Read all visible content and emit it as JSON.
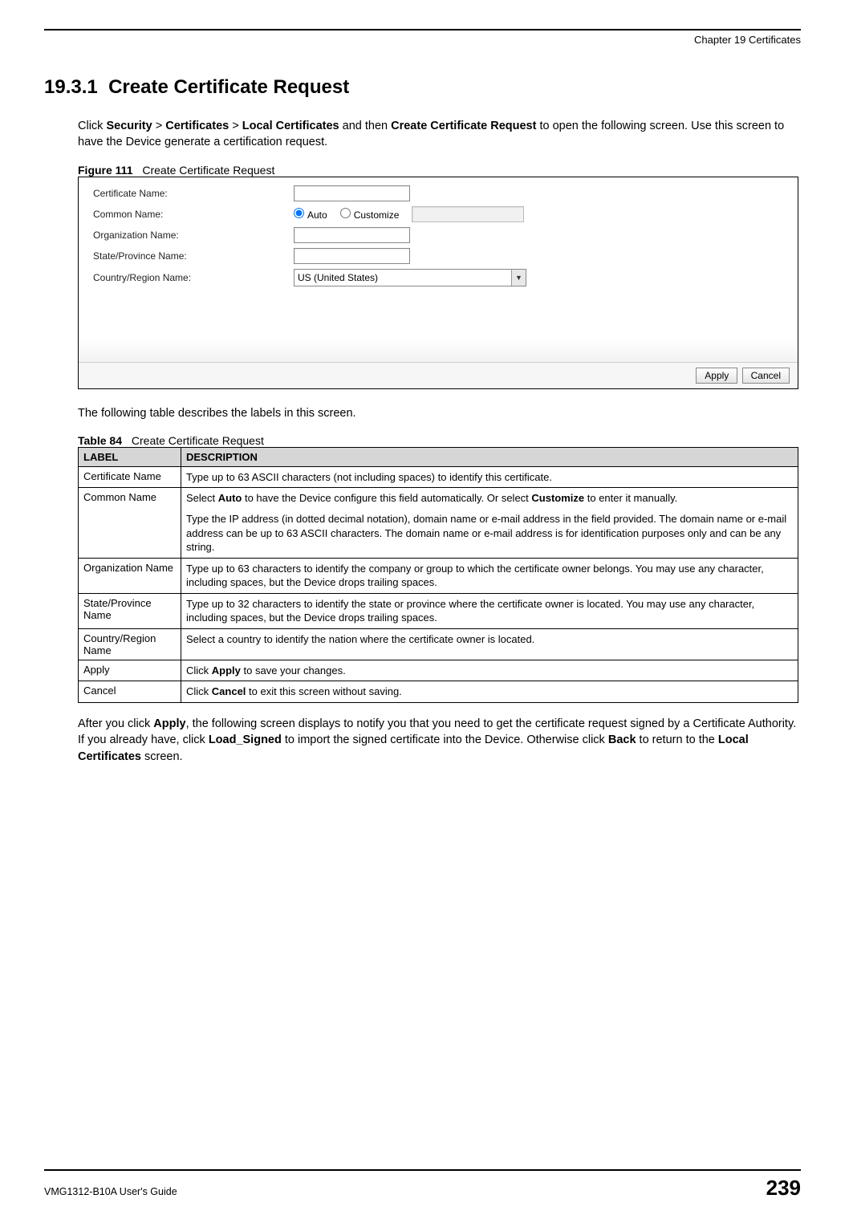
{
  "header": {
    "chapter": "Chapter 19 Certificates"
  },
  "section": {
    "number": "19.3.1",
    "title": "Create Certificate Request"
  },
  "intro": {
    "pre": "Click ",
    "nav1": "Security",
    "sep1": " > ",
    "nav2": "Certificates",
    "sep2": " > ",
    "nav3": "Local Certificates",
    "mid": " and then ",
    "action": "Create Certificate Request",
    "post": " to open the following screen. Use this screen to have the Device generate a certification request."
  },
  "figure": {
    "label": "Figure 111",
    "caption": "Create Certificate Request",
    "form": {
      "cert_name_label": "Certificate Name:",
      "common_name_label": "Common Name:",
      "radio_auto": "Auto",
      "radio_customize": "Customize",
      "org_name_label": "Organization Name:",
      "state_name_label": "State/Province Name:",
      "country_name_label": "Country/Region Name:",
      "country_value": "US (United States)",
      "apply_label": "Apply",
      "cancel_label": "Cancel"
    }
  },
  "table_intro": "The following table describes the labels in this screen.",
  "table": {
    "label": "Table 84",
    "caption": "Create Certificate Request",
    "header_label": "LABEL",
    "header_desc": "DESCRIPTION",
    "rows": [
      {
        "label": "Certificate Name",
        "desc": "Type up to 63 ASCII characters (not including spaces) to identify this certificate."
      },
      {
        "label": "Common Name",
        "desc_p1_a": "Select ",
        "desc_p1_b": "Auto",
        "desc_p1_c": " to have the Device configure this field automatically. Or select ",
        "desc_p1_d": "Customize",
        "desc_p1_e": " to enter it manually.",
        "desc_p2": "Type the IP address (in dotted decimal notation), domain name or e-mail address in the field provided. The domain name or e-mail address can be up to 63 ASCII characters. The domain name or e-mail address is for identification purposes only and can be any string."
      },
      {
        "label": "Organization Name",
        "desc": "Type up to 63 characters to identify the company or group to which the certificate owner belongs. You may use any character, including spaces, but the Device drops trailing spaces."
      },
      {
        "label": "State/Province Name",
        "desc": "Type up to 32 characters to identify the state or province where the certificate owner is located. You may use any character, including spaces, but the Device drops trailing spaces."
      },
      {
        "label": "Country/Region Name",
        "desc": "Select a country to identify the nation where the certificate owner is located."
      },
      {
        "label": "Apply",
        "desc_a": "Click ",
        "desc_b": "Apply",
        "desc_c": " to save your changes."
      },
      {
        "label": "Cancel",
        "desc_a": "Click ",
        "desc_b": "Cancel",
        "desc_c": " to exit this screen without saving."
      }
    ]
  },
  "outro": {
    "a": "After you click ",
    "b": "Apply",
    "c": ", the following screen displays to notify you that you need to get the certificate request signed by a Certificate Authority. If you already have, click ",
    "d": "Load_Signed",
    "e": " to import the signed certificate into the Device. Otherwise click ",
    "f": "Back",
    "g": " to return to the ",
    "h": "Local Certificates",
    "i": " screen."
  },
  "footer": {
    "guide": "VMG1312-B10A User's Guide",
    "page": "239"
  }
}
